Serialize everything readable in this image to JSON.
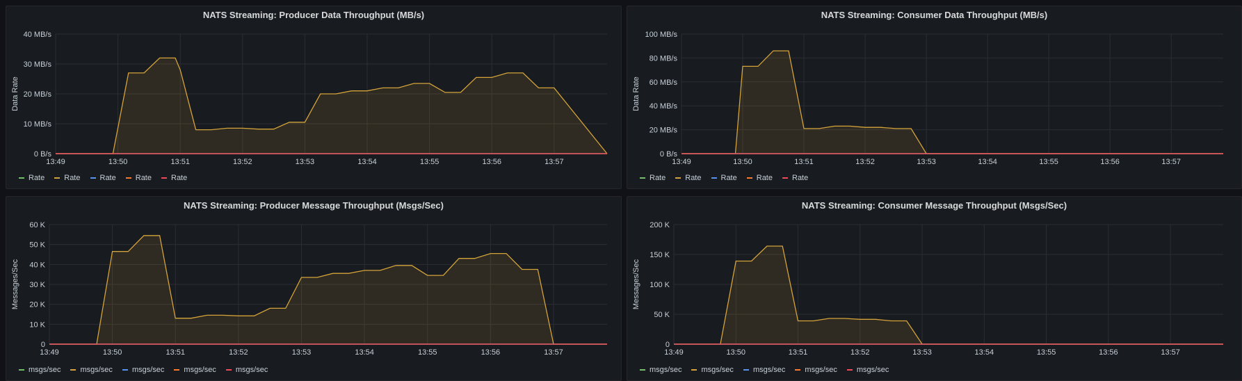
{
  "chart_data": [
    {
      "type": "area",
      "title": "NATS Streaming: Producer Data Throughput (MB/s)",
      "ylabel": "Data Rate",
      "unit": "MB/s",
      "y_ticks": [
        0,
        10,
        20,
        30,
        40
      ],
      "y_tick_labels": [
        "0 B/s",
        "10 MB/s",
        "20 MB/s",
        "30 MB/s",
        "40 MB/s"
      ],
      "ylim": [
        0,
        40
      ],
      "x_ticks": [
        0,
        1,
        2,
        3,
        4,
        5,
        6,
        7,
        8
      ],
      "x_tick_labels": [
        "13:49",
        "13:50",
        "13:51",
        "13:52",
        "13:53",
        "13:54",
        "13:55",
        "13:56",
        "13:57"
      ],
      "xlim": [
        0,
        8.85
      ],
      "grid": true,
      "legend_position": "bottom-left",
      "series": [
        {
          "name": "Rate",
          "color": "#73bf69",
          "x": [
            0,
            8.85
          ],
          "y": [
            0,
            0
          ]
        },
        {
          "name": "Rate",
          "color": "#d4a33a",
          "fill": true,
          "x": [
            0,
            0.92,
            1.17,
            1.42,
            1.67,
            1.92,
            2.0,
            2.25,
            2.5,
            2.75,
            3.0,
            3.25,
            3.5,
            3.75,
            4.0,
            4.25,
            4.5,
            4.75,
            5.0,
            5.25,
            5.5,
            5.75,
            6.0,
            6.25,
            6.5,
            6.75,
            7.0,
            7.25,
            7.5,
            7.75,
            8.0,
            8.85
          ],
          "y": [
            0,
            0,
            27,
            27,
            32,
            32,
            28,
            8,
            8,
            8.5,
            8.5,
            8.2,
            8.2,
            10.5,
            10.5,
            20,
            20,
            21,
            21,
            22,
            22,
            23.5,
            23.5,
            20.5,
            20.5,
            25.5,
            25.5,
            27,
            27,
            22,
            22,
            0
          ]
        },
        {
          "name": "Rate",
          "color": "#5794f2",
          "x": [
            0,
            8.85
          ],
          "y": [
            0,
            0
          ]
        },
        {
          "name": "Rate",
          "color": "#ff7a2f",
          "x": [
            0,
            8.85
          ],
          "y": [
            0,
            0
          ]
        },
        {
          "name": "Rate",
          "color": "#f2495c",
          "x": [
            0,
            8.85
          ],
          "y": [
            0,
            0
          ]
        }
      ]
    },
    {
      "type": "area",
      "title": "NATS Streaming: Consumer Data Throughput (MB/s)",
      "ylabel": "Data Rate",
      "unit": "MB/s",
      "y_ticks": [
        0,
        20,
        40,
        60,
        80,
        100
      ],
      "y_tick_labels": [
        "0 B/s",
        "20 MB/s",
        "40 MB/s",
        "60 MB/s",
        "80 MB/s",
        "100 MB/s"
      ],
      "ylim": [
        0,
        100
      ],
      "x_ticks": [
        0,
        1,
        2,
        3,
        4,
        5,
        6,
        7,
        8
      ],
      "x_tick_labels": [
        "13:49",
        "13:50",
        "13:51",
        "13:52",
        "13:53",
        "13:54",
        "13:55",
        "13:56",
        "13:57"
      ],
      "xlim": [
        0,
        8.85
      ],
      "grid": true,
      "legend_position": "bottom-left",
      "series": [
        {
          "name": "Rate",
          "color": "#73bf69",
          "x": [
            0,
            8.85
          ],
          "y": [
            0,
            0
          ]
        },
        {
          "name": "Rate",
          "color": "#d4a33a",
          "fill": true,
          "x": [
            0,
            0.88,
            1.0,
            1.25,
            1.5,
            1.75,
            2.0,
            2.25,
            2.5,
            2.75,
            3.0,
            3.25,
            3.5,
            3.75,
            4.0,
            8.85
          ],
          "y": [
            0,
            0,
            73,
            73,
            86,
            86,
            21,
            21,
            23,
            23,
            22,
            22,
            21,
            21,
            0,
            0
          ]
        },
        {
          "name": "Rate",
          "color": "#5794f2",
          "x": [
            0,
            8.85
          ],
          "y": [
            0,
            0
          ]
        },
        {
          "name": "Rate",
          "color": "#ff7a2f",
          "x": [
            0,
            8.85
          ],
          "y": [
            0,
            0
          ]
        },
        {
          "name": "Rate",
          "color": "#f2495c",
          "x": [
            0,
            8.85
          ],
          "y": [
            0,
            0
          ]
        }
      ]
    },
    {
      "type": "area",
      "title": "NATS Streaming: Producer Message Throughput (Msgs/Sec)",
      "ylabel": "Messages/Sec",
      "unit": "msgs/sec",
      "y_ticks": [
        0,
        10000,
        20000,
        30000,
        40000,
        50000,
        60000
      ],
      "y_tick_labels": [
        "0",
        "10 K",
        "20 K",
        "30 K",
        "40 K",
        "50 K",
        "60 K"
      ],
      "ylim": [
        0,
        60000
      ],
      "x_ticks": [
        0,
        1,
        2,
        3,
        4,
        5,
        6,
        7,
        8
      ],
      "x_tick_labels": [
        "13:49",
        "13:50",
        "13:51",
        "13:52",
        "13:53",
        "13:54",
        "13:55",
        "13:56",
        "13:57"
      ],
      "xlim": [
        0,
        8.85
      ],
      "grid": true,
      "legend_position": "bottom-left",
      "series": [
        {
          "name": "msgs/sec",
          "color": "#73bf69",
          "x": [
            0,
            8.85
          ],
          "y": [
            0,
            0
          ]
        },
        {
          "name": "msgs/sec",
          "color": "#d4a33a",
          "fill": true,
          "x": [
            0,
            0.75,
            1.0,
            1.25,
            1.5,
            1.75,
            2.0,
            2.25,
            2.5,
            2.75,
            3.0,
            3.25,
            3.5,
            3.75,
            4.0,
            4.25,
            4.5,
            4.75,
            5.0,
            5.25,
            5.5,
            5.75,
            6.0,
            6.25,
            6.5,
            6.75,
            7.0,
            7.25,
            7.5,
            7.75,
            8.0,
            8.85
          ],
          "y": [
            0,
            0,
            46500,
            46500,
            54500,
            54500,
            13000,
            13000,
            14500,
            14500,
            14200,
            14200,
            18000,
            18000,
            33500,
            33500,
            35500,
            35500,
            37000,
            37000,
            39500,
            39500,
            34500,
            34500,
            43000,
            43000,
            45500,
            45500,
            37500,
            37500,
            0,
            0
          ]
        },
        {
          "name": "msgs/sec",
          "color": "#5794f2",
          "x": [
            0,
            8.85
          ],
          "y": [
            0,
            0
          ]
        },
        {
          "name": "msgs/sec",
          "color": "#ff7a2f",
          "x": [
            0,
            8.85
          ],
          "y": [
            0,
            0
          ]
        },
        {
          "name": "msgs/sec",
          "color": "#f2495c",
          "x": [
            0,
            8.85
          ],
          "y": [
            0,
            0
          ]
        }
      ]
    },
    {
      "type": "area",
      "title": "NATS Streaming: Consumer Message Throughput (Msgs/Sec)",
      "ylabel": "Messages/Sec",
      "unit": "msgs/sec",
      "y_ticks": [
        0,
        50000,
        100000,
        150000,
        200000
      ],
      "y_tick_labels": [
        "0",
        "50 K",
        "100 K",
        "150 K",
        "200 K"
      ],
      "ylim": [
        0,
        200000
      ],
      "x_ticks": [
        0,
        1,
        2,
        3,
        4,
        5,
        6,
        7,
        8
      ],
      "x_tick_labels": [
        "13:49",
        "13:50",
        "13:51",
        "13:52",
        "13:53",
        "13:54",
        "13:55",
        "13:56",
        "13:57"
      ],
      "xlim": [
        0,
        8.85
      ],
      "grid": true,
      "legend_position": "bottom-left",
      "series": [
        {
          "name": "msgs/sec",
          "color": "#73bf69",
          "x": [
            0,
            8.85
          ],
          "y": [
            0,
            0
          ]
        },
        {
          "name": "msgs/sec",
          "color": "#d4a33a",
          "fill": true,
          "x": [
            0,
            0.75,
            1.0,
            1.25,
            1.5,
            1.75,
            2.0,
            2.25,
            2.5,
            2.75,
            3.0,
            3.25,
            3.5,
            3.75,
            4.0,
            8.85
          ],
          "y": [
            0,
            0,
            139000,
            139000,
            164000,
            164000,
            39000,
            39000,
            43000,
            43000,
            41500,
            41500,
            39000,
            39000,
            0,
            0
          ]
        },
        {
          "name": "msgs/sec",
          "color": "#5794f2",
          "x": [
            0,
            8.85
          ],
          "y": [
            0,
            0
          ]
        },
        {
          "name": "msgs/sec",
          "color": "#ff7a2f",
          "x": [
            0,
            8.85
          ],
          "y": [
            0,
            0
          ]
        },
        {
          "name": "msgs/sec",
          "color": "#f2495c",
          "x": [
            0,
            8.85
          ],
          "y": [
            0,
            0
          ]
        }
      ]
    }
  ]
}
